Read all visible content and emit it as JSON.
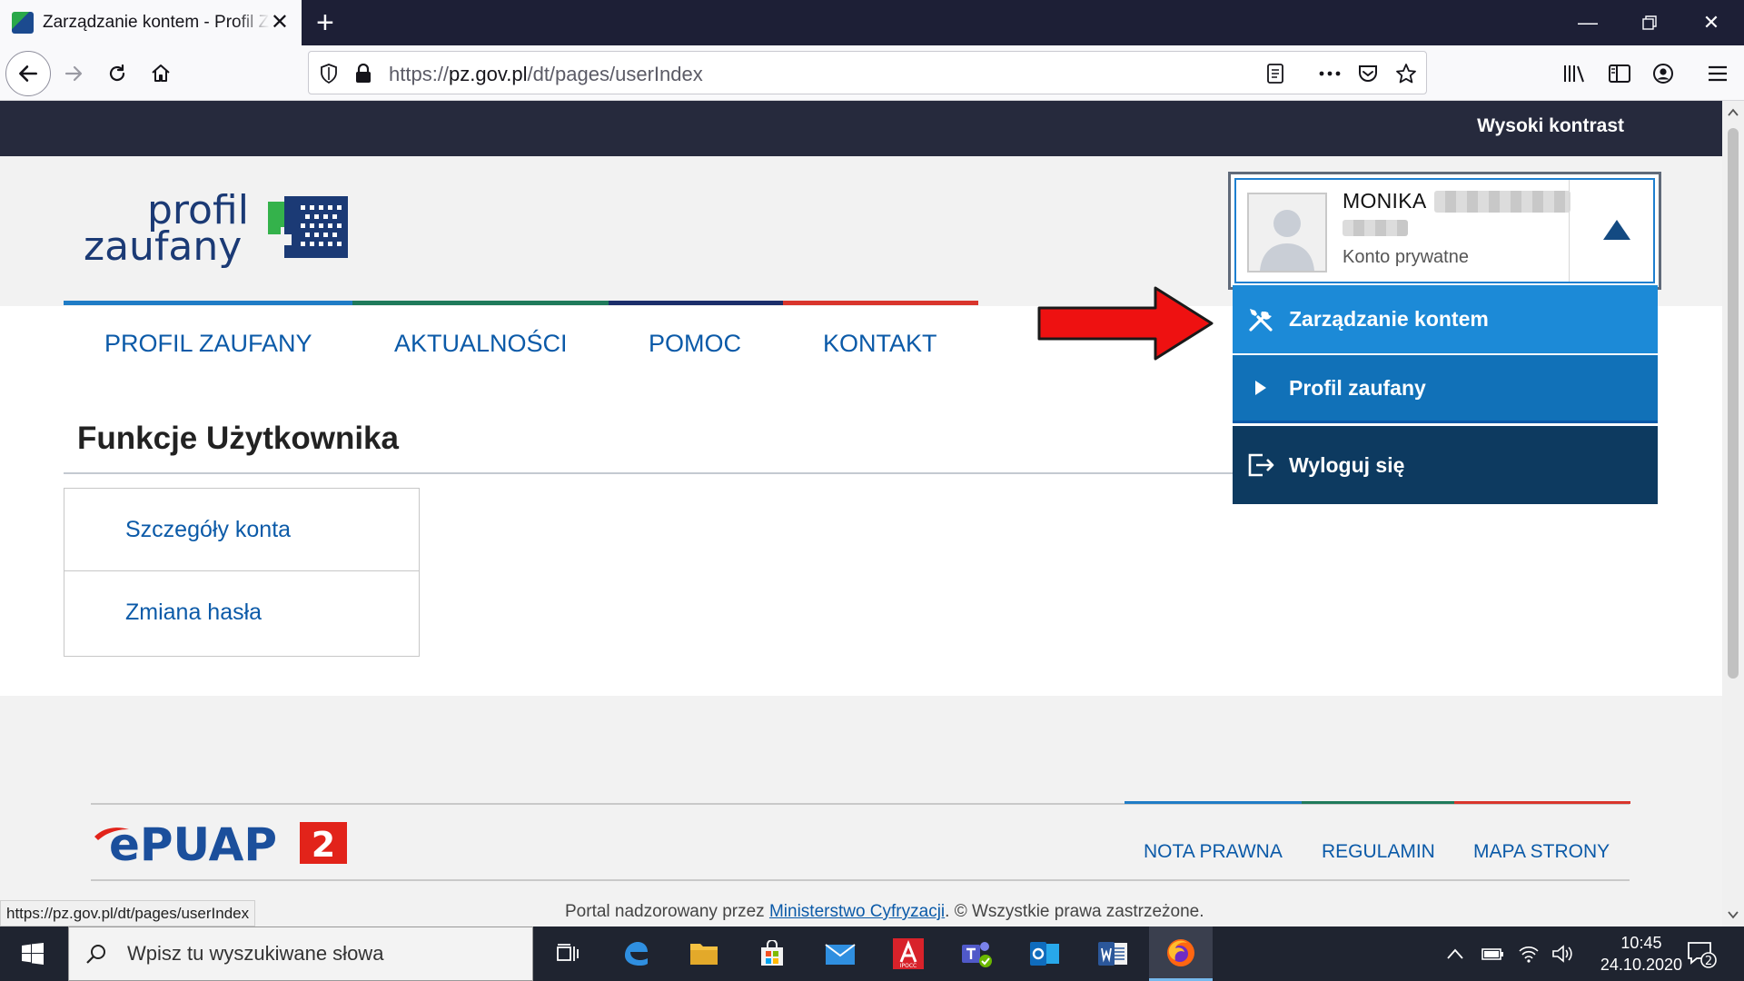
{
  "browser": {
    "tab_title": "Zarządzanie kontem - Profil Zaufany",
    "url_prefix": "https://",
    "url_host": "pz.gov.pl",
    "url_path": "/dt/pages/userIndex",
    "status_url": "https://pz.gov.pl/dt/pages/userIndex"
  },
  "page": {
    "contrast_label": "Wysoki kontrast",
    "logo_line1": "profil",
    "logo_line2": "zaufany",
    "menu": [
      {
        "label": "PROFIL ZAUFANY"
      },
      {
        "label": "AKTUALNOŚCI"
      },
      {
        "label": "POMOC"
      },
      {
        "label": "KONTAKT"
      }
    ],
    "section_title": "Funkcje Użytkownika",
    "functions": [
      {
        "label": "Szczegóły konta"
      },
      {
        "label": "Zmiana hasła"
      }
    ],
    "user": {
      "name": "MONIKA",
      "account_type": "Konto prywatne"
    },
    "dropdown": [
      {
        "label": "Zarządzanie kontem",
        "icon": "tools-icon"
      },
      {
        "label": "Profil zaufany",
        "icon": "play-icon"
      },
      {
        "label": "Wyloguj się",
        "icon": "logout-icon"
      }
    ],
    "footer": {
      "epuap_text": "ePUAP",
      "epuap_num": "2",
      "links": [
        {
          "label": "NOTA PRAWNA"
        },
        {
          "label": "REGULAMIN"
        },
        {
          "label": "MAPA STRONY"
        }
      ],
      "copyright_prefix": "Portal nadzorowany przez ",
      "copyright_link": "Ministerstwo Cyfryzacji",
      "copyright_suffix": ". © Wszystkie prawa zastrzeżone."
    }
  },
  "taskbar": {
    "search_placeholder": "Wpisz tu wyszukiwane słowa",
    "time": "10:45",
    "date": "24.10.2020",
    "notifications": "2",
    "ipocc_label": "IPOCC"
  },
  "colors": {
    "accent": "#0b5aa8",
    "dropdown_active": "#1c8ad7",
    "dropdown_mid": "#1171b8",
    "dropdown_dark": "#0d3a60",
    "arrow": "#ee1111"
  }
}
